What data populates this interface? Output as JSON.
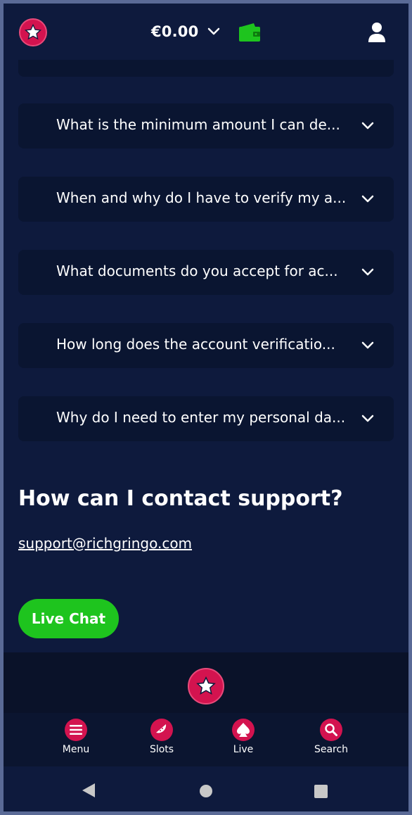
{
  "header": {
    "balance": "€0.00",
    "logo_icon": "star-logo-icon",
    "wallet_icon": "wallet-icon",
    "user_icon": "user-icon",
    "colors": {
      "brand": "#d3134f",
      "wallet": "#1ec41e",
      "background": "#0e1a3d"
    }
  },
  "faq": {
    "items": [
      {
        "question": "What is the minimum amount I can de..."
      },
      {
        "question": "When and why do I have to verify my a..."
      },
      {
        "question": "What documents do you accept for ac..."
      },
      {
        "question": "How long does the account verificatio..."
      },
      {
        "question": "Why do I need to enter my personal da..."
      }
    ]
  },
  "support": {
    "title": "How can I contact support?",
    "email": "support@richgringo.com",
    "live_chat_label": "Live Chat"
  },
  "bottom_nav": {
    "items": [
      {
        "label": "Menu",
        "icon": "menu-icon"
      },
      {
        "label": "Slots",
        "icon": "watermelon-icon"
      },
      {
        "label": "Live",
        "icon": "spade-icon"
      },
      {
        "label": "Search",
        "icon": "search-icon"
      }
    ]
  }
}
